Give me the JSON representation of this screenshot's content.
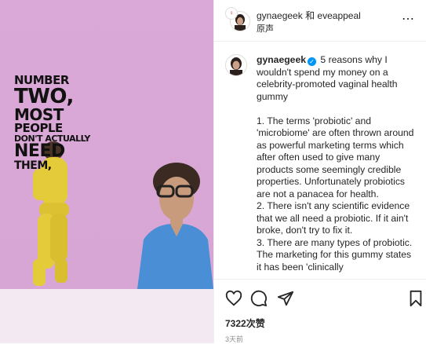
{
  "media": {
    "overlay_lines": [
      "NUMBER",
      "TWO,",
      "MOST",
      "PEOPLE",
      "DON'T ACTUALLY",
      "NEED",
      "THEM,"
    ],
    "background_color": "#dba9d7"
  },
  "header": {
    "author": "gynaegeek",
    "connector": "和",
    "coauthor": "eveappeal",
    "audio_label": "原声",
    "more_label": "⋯"
  },
  "post": {
    "username": "gynaegeek",
    "lines": [
      "5 reasons why I wouldn't spend my money on a celebrity-promoted vaginal health gummy",
      "",
      "1. The terms 'probiotic' and 'microbiome' are often thrown around as powerful marketing terms which after often used to give many products some seemingly credible properties. Unfortunately probiotics are not a panacea for health.",
      "2. There isn't any scientific evidence that we all need a probiotic. If it ain't broke, don't try to fix it.",
      "3. There are many types of probiotic. The marketing for this gummy states it has been 'clinically"
    ]
  },
  "actions": {
    "like_icon": "heart-icon",
    "comment_icon": "comment-icon",
    "share_icon": "send-icon",
    "save_icon": "bookmark-icon",
    "likes_text": "7322次赞",
    "time_text": "3天前"
  }
}
